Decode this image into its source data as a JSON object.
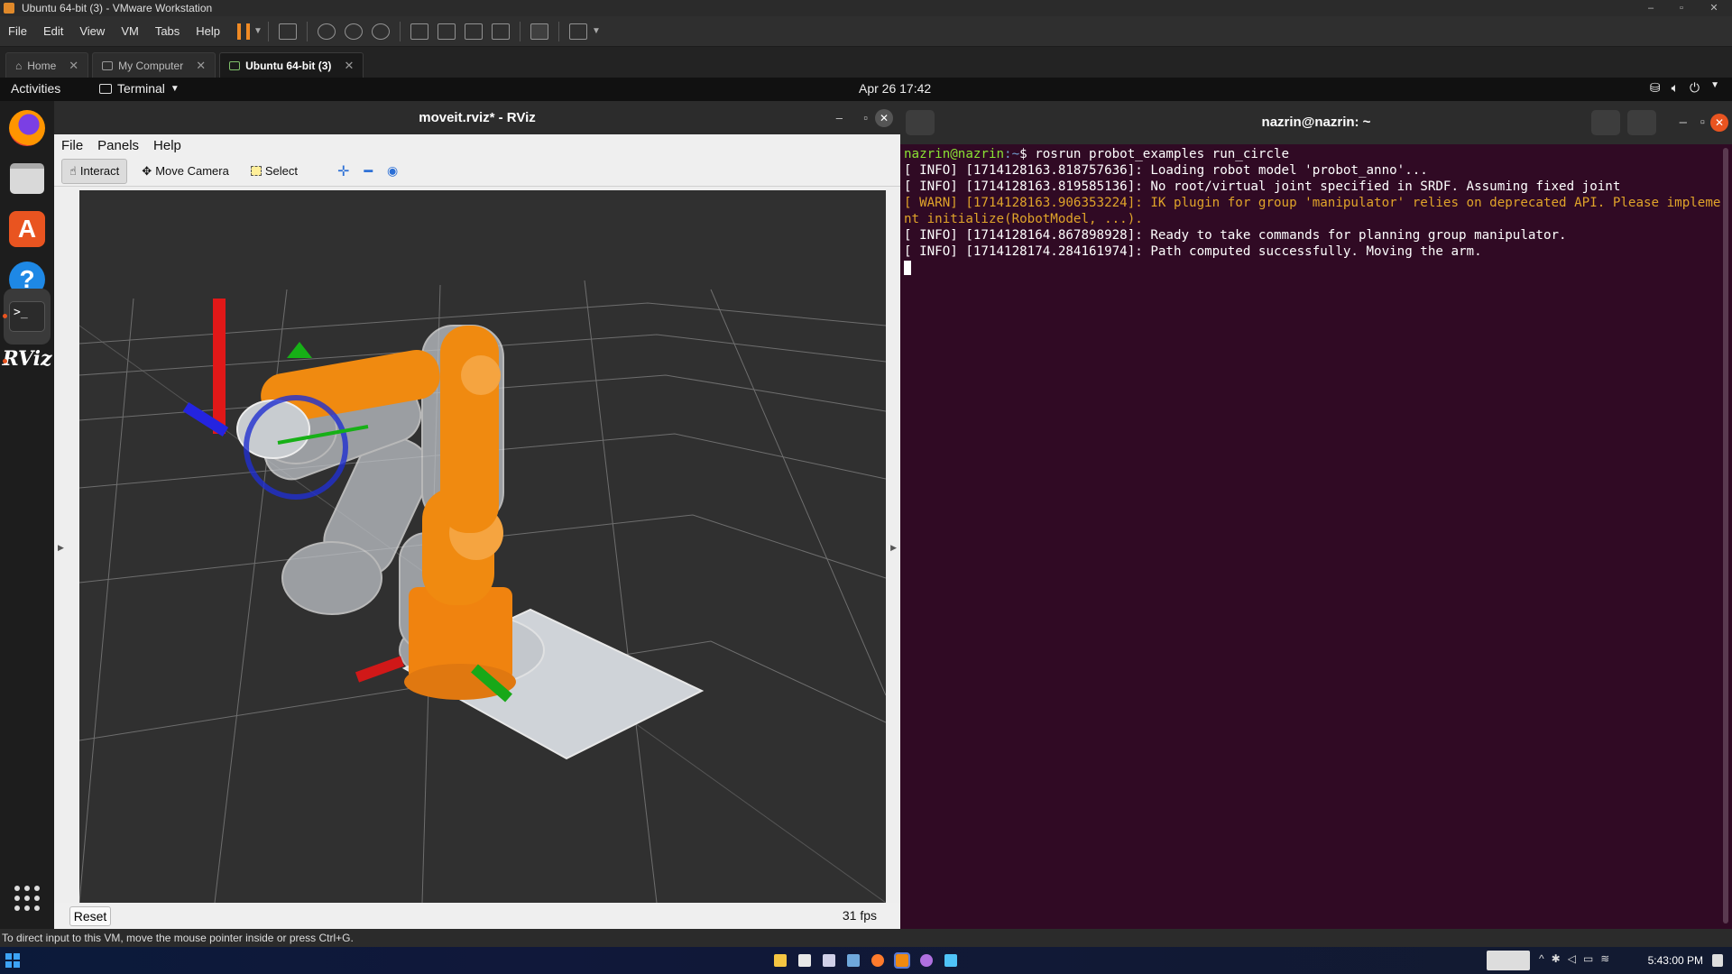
{
  "vmware": {
    "title": "Ubuntu 64-bit (3) - VMware Workstation",
    "menu": [
      "File",
      "Edit",
      "View",
      "VM",
      "Tabs",
      "Help"
    ],
    "tabs": [
      {
        "label": "Home"
      },
      {
        "label": "My Computer"
      },
      {
        "label": "Ubuntu 64-bit (3)"
      }
    ],
    "status_message": "To direct input to this VM, move the mouse pointer inside or press Ctrl+G."
  },
  "ubuntu_topbar": {
    "activities": "Activities",
    "app_menu": "Terminal",
    "clock": "Apr 26  17:42"
  },
  "rviz": {
    "title": "moveit.rviz* - RViz",
    "menu": [
      "File",
      "Panels",
      "Help"
    ],
    "tools": [
      "Interact",
      "Move Camera",
      "Select"
    ],
    "reset_label": "Reset",
    "fps": "31 fps"
  },
  "terminal": {
    "title": "nazrin@nazrin: ~",
    "prompt_user": "nazrin@nazrin",
    "prompt_path": ":~",
    "command": "$ rosrun probot_examples run_circle",
    "lines": [
      {
        "text": "[ INFO] [1714128163.818757636]: Loading robot model 'probot_anno'...",
        "level": "info"
      },
      {
        "text": "[ INFO] [1714128163.819585136]: No root/virtual joint specified in SRDF. Assuming fixed joint",
        "level": "info"
      },
      {
        "text": "[ WARN] [1714128163.906353224]: IK plugin for group 'manipulator' relies on deprecated API. Please implement initialize(RobotModel, ...).",
        "level": "warn"
      },
      {
        "text": "[ INFO] [1714128164.867898928]: Ready to take commands for planning group manipulator.",
        "level": "info"
      },
      {
        "text": "[ INFO] [1714128174.284161974]: Path computed successfully. Moving the arm.",
        "level": "info"
      }
    ]
  },
  "windows_taskbar": {
    "clock": "5:43:00 PM"
  },
  "colors": {
    "ubuntu_orange": "#e95420",
    "terminal_bg": "#300a24",
    "robot_orange": "#f08a10",
    "prompt_green": "#8ae234",
    "warn_yellow": "#e0a42a"
  },
  "icons": [
    "firefox-icon",
    "files-icon",
    "software-center-icon",
    "help-icon",
    "terminal-icon",
    "rviz-icon",
    "app-grid-icon"
  ]
}
